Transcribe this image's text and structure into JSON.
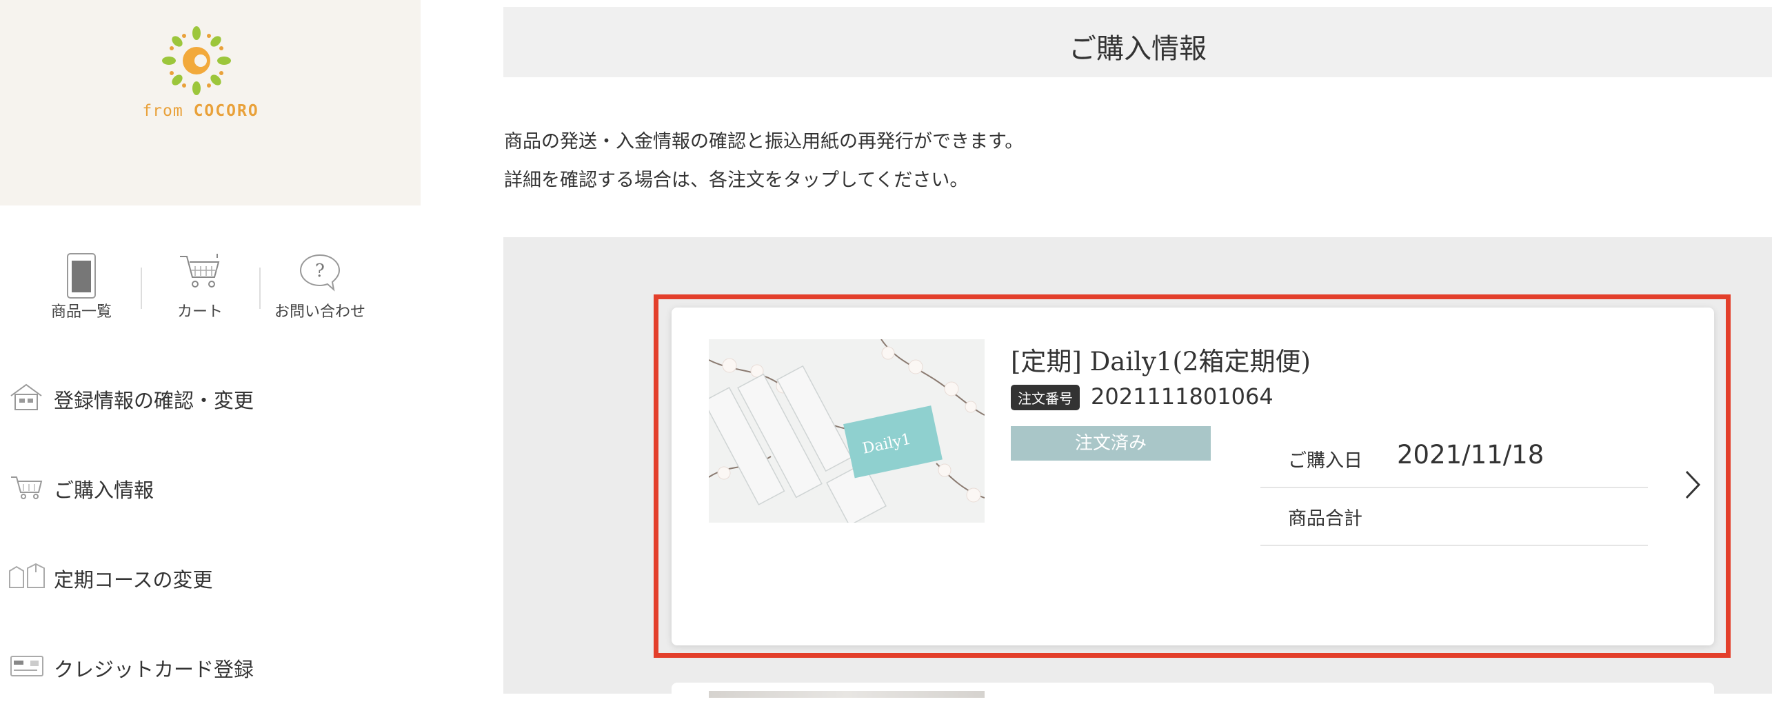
{
  "sidebar": {
    "logo": {
      "prefix": "from",
      "brand": "COCORO"
    },
    "quicknav": [
      {
        "label": "商品一覧",
        "icon": "product-list-icon"
      },
      {
        "label": "カート",
        "icon": "cart-icon"
      },
      {
        "label": "お問い合わせ",
        "icon": "question-icon"
      }
    ],
    "menu": [
      {
        "label": "登録情報の確認・変更",
        "icon": "house-icon"
      },
      {
        "label": "ご購入情報",
        "icon": "cart-icon"
      },
      {
        "label": "定期コースの変更",
        "icon": "boxes-icon"
      },
      {
        "label": "クレジットカード登録",
        "icon": "credit-card-icon"
      }
    ]
  },
  "main": {
    "title": "ご購入情報",
    "intro_line1": "商品の発送・入金情報の確認と振込用紙の再発行ができます。",
    "intro_line2": "詳細を確認する場合は、各注文をタップしてください。",
    "orders": [
      {
        "product_title": "[定期] Daily1(2箱定期便)",
        "order_badge": "注文番号",
        "order_number": "2021111801064",
        "status": "注文済み",
        "purchase_date_label": "ご購入日",
        "purchase_date": "2021/11/18",
        "total_label": "商品合計",
        "total_value": ""
      }
    ]
  },
  "colors": {
    "highlight_border": "#e33f2b",
    "status_bg": "#a9c6c8",
    "logo_orange": "#e9a13a",
    "logo_green": "#9cc63b",
    "logo_panel_bg": "#f6f3ee"
  }
}
